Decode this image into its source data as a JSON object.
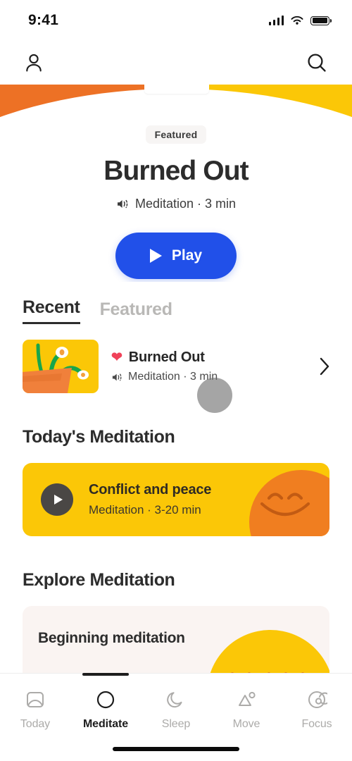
{
  "status_bar": {
    "time": "9:41",
    "cellular": "signal-bars",
    "wifi": "wifi-icon",
    "battery": "battery-full-icon"
  },
  "app_bar": {
    "profile_icon": "person-icon",
    "search_icon": "search-icon"
  },
  "hero": {
    "badge": "Featured",
    "title": "Burned Out",
    "meta": "Meditation · 3 min",
    "meta_icon": "speaker-icon",
    "play_label": "Play",
    "play_icon": "play-triangle-icon",
    "band_left_color": "#ED7125",
    "band_right_color": "#FBC707",
    "play_button_color": "#2150E9"
  },
  "segmented": {
    "tabs": [
      {
        "label": "Recent",
        "active": true
      },
      {
        "label": "Featured",
        "active": false
      }
    ]
  },
  "recent": {
    "item": {
      "title": "Burned Out",
      "meta": "Meditation · 3 min",
      "favorite_icon": "heart-icon",
      "favorite_color": "#F04259",
      "meta_icon": "speaker-icon",
      "chevron_icon": "chevron-right-icon",
      "thumbnail": "plant-in-pot-illustration"
    }
  },
  "todays_meditation": {
    "heading": "Today's Meditation",
    "card": {
      "title": "Conflict and peace",
      "meta": "Meditation · 3-20 min",
      "play_icon": "play-circle-icon",
      "art": "smiling-face-blob",
      "bg_color": "#FBC707",
      "blob_color": "#F07E20"
    }
  },
  "explore": {
    "heading": "Explore Meditation",
    "card": {
      "title": "Beginning meditation",
      "art": "yellow-dome",
      "bg_color": "#FAF4F2"
    }
  },
  "tab_bar": {
    "tabs": [
      {
        "label": "Today",
        "icon": "today-card-icon",
        "active": false
      },
      {
        "label": "Meditate",
        "icon": "circle-icon",
        "active": true
      },
      {
        "label": "Sleep",
        "icon": "moon-icon",
        "active": false
      },
      {
        "label": "Move",
        "icon": "mountain-sun-icon",
        "active": false
      },
      {
        "label": "Focus",
        "icon": "spiral-icon",
        "active": false
      }
    ]
  },
  "cursor": {
    "type": "touch-indicator"
  }
}
